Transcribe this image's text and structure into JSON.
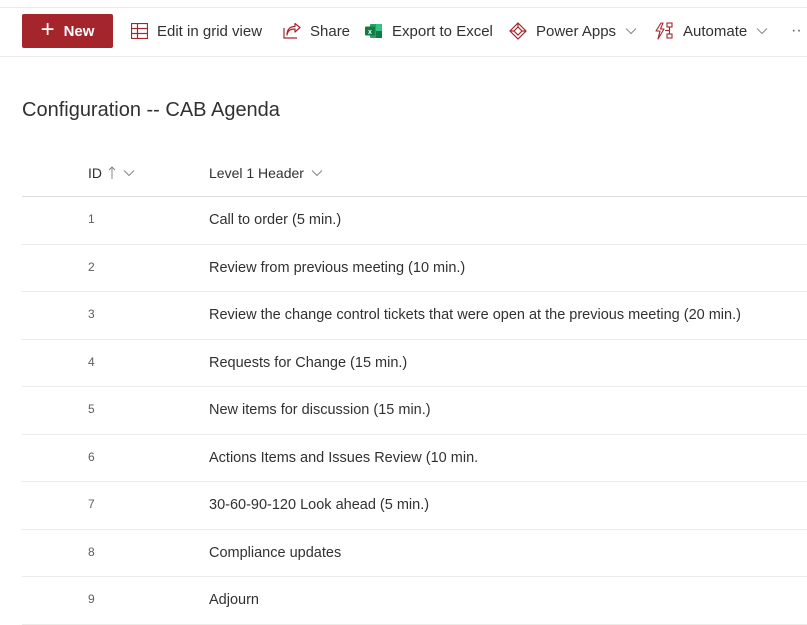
{
  "commandbar": {
    "new_label": "New",
    "edit_grid_label": "Edit in grid view",
    "share_label": "Share",
    "export_label": "Export to Excel",
    "power_apps_label": "Power Apps",
    "automate_label": "Automate",
    "more_label": "··"
  },
  "colors": {
    "accent": "#a4262c",
    "excel_green": "#107c41",
    "text": "#323130",
    "subtle_text": "#605e5c"
  },
  "page": {
    "title": "Configuration -- CAB Agenda"
  },
  "table": {
    "columns": [
      {
        "label": "ID",
        "sorted": "ascending"
      },
      {
        "label": "Level 1 Header"
      }
    ],
    "rows": [
      {
        "id": "1",
        "level1": "Call to order (5 min.)"
      },
      {
        "id": "2",
        "level1": "Review from previous meeting (10 min.)"
      },
      {
        "id": "3",
        "level1": "Review the change control tickets that were open at the previous meeting (20 min.)"
      },
      {
        "id": "4",
        "level1": "Requests for Change (15 min.)"
      },
      {
        "id": "5",
        "level1": "New items for discussion (15 min.)"
      },
      {
        "id": "6",
        "level1": "Actions Items and Issues Review (10 min."
      },
      {
        "id": "7",
        "level1": "30-60-90-120 Look ahead (5 min.)"
      },
      {
        "id": "8",
        "level1": "Compliance updates"
      },
      {
        "id": "9",
        "level1": "Adjourn"
      }
    ]
  }
}
